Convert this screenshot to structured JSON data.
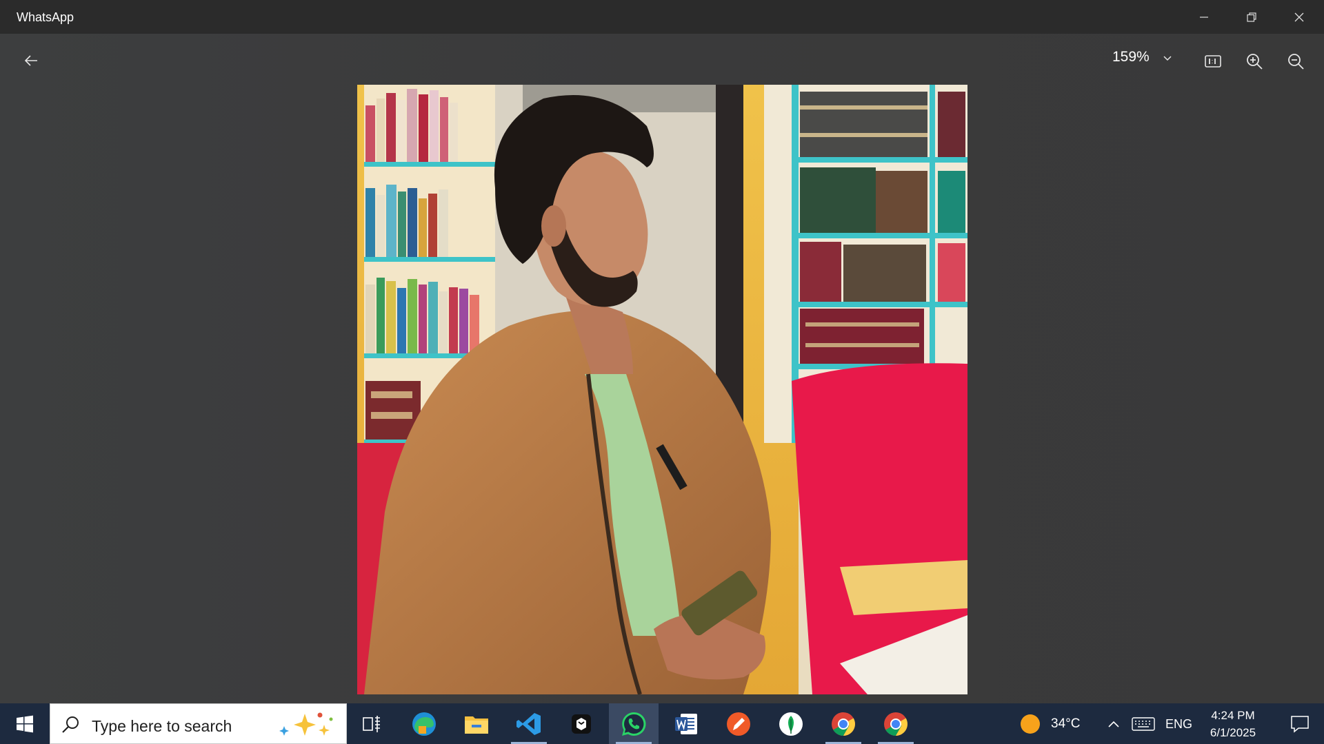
{
  "window": {
    "title": "WhatsApp",
    "controls": [
      "minimize-icon",
      "restore-icon",
      "close-icon"
    ]
  },
  "viewer": {
    "zoom_value": "159%",
    "toolbar_icons": [
      "back-arrow-icon",
      "chevron-down-icon",
      "actual-size-icon",
      "zoom-in-icon",
      "zoom-out-icon"
    ],
    "background_color": "#3a3a3a"
  },
  "photo": {
    "dominant_colors": {
      "shelf": "#3ec3c8",
      "wall": "#e9b23d",
      "jacket": "#b87a45",
      "shirt": "#a9d39b",
      "chair": "#e8194a"
    }
  },
  "taskbar": {
    "search_placeholder": "Type here to search",
    "pinned_apps": [
      "task-view-icon",
      "edge-icon",
      "file-explorer-icon",
      "vscode-icon",
      "terminal-icon",
      "whatsapp-icon",
      "word-icon",
      "pen-app-icon",
      "leaf-app-icon",
      "chrome-icon",
      "chrome-icon"
    ],
    "active_app": "whatsapp-icon",
    "weather": {
      "temperature": "34°C",
      "icon": "sun-icon"
    },
    "language": "ENG",
    "time": "4:24 PM",
    "date": "6/1/2025",
    "colors": {
      "background": "#1d2a3f",
      "active": "#3b4a63"
    }
  }
}
